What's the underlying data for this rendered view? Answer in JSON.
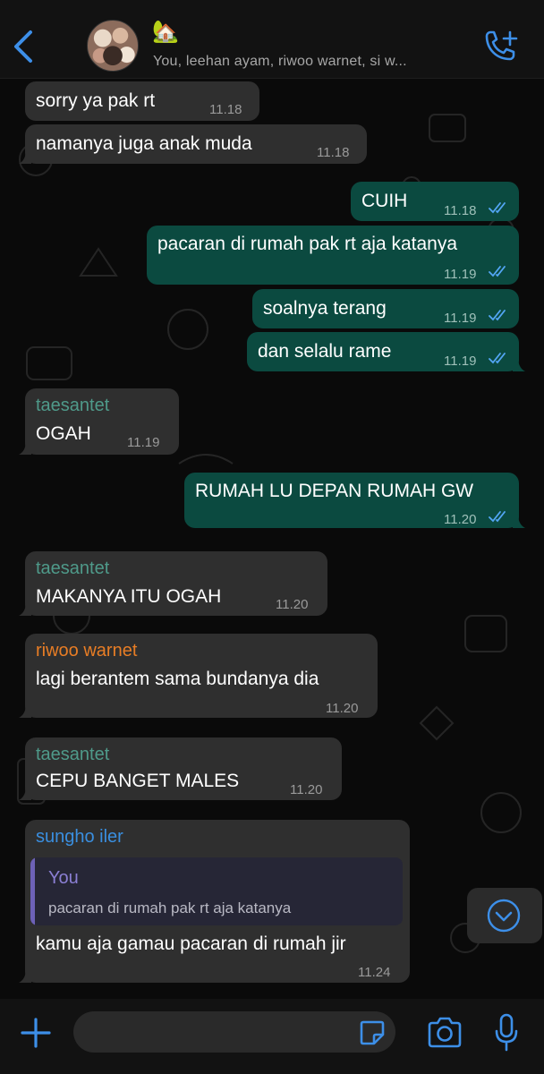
{
  "header": {
    "group_emoji": "🏡",
    "members": "You, leehan ayam, riwoo warnet, si w..."
  },
  "composer": {
    "placeholder": ""
  },
  "colors": {
    "accent": "#3d8fe8",
    "incoming_bubble": "#2f2f2f",
    "outgoing_bubble": "#0b4a40",
    "sender_taesantet": "#4f9a8a",
    "sender_riwoo": "#e87d25",
    "sender_sungho": "#3a8fe0",
    "quote_name": "#8b7fd4",
    "read_ticks": "#53a6f5"
  },
  "messages": [
    {
      "dir": "in",
      "text": "sorry ya pak rt",
      "time": "11.18"
    },
    {
      "dir": "in",
      "text": "namanya juga anak muda",
      "time": "11.18"
    },
    {
      "dir": "out",
      "text": "CUIH",
      "time": "11.18",
      "status": "read"
    },
    {
      "dir": "out",
      "text": "pacaran di rumah pak rt aja katanya",
      "time": "11.19",
      "status": "read"
    },
    {
      "dir": "out",
      "text": "soalnya terang",
      "time": "11.19",
      "status": "read"
    },
    {
      "dir": "out",
      "text": "dan selalu rame",
      "time": "11.19",
      "status": "read"
    },
    {
      "dir": "in",
      "sender": "taesantet",
      "text": "OGAH",
      "time": "11.19"
    },
    {
      "dir": "out",
      "text": "RUMAH LU DEPAN RUMAH GW",
      "time": "11.20",
      "status": "read"
    },
    {
      "dir": "in",
      "sender": "taesantet",
      "text": "MAKANYA ITU OGAH",
      "time": "11.20"
    },
    {
      "dir": "in",
      "sender": "riwoo warnet",
      "text": "lagi berantem sama bundanya dia",
      "time": "11.20"
    },
    {
      "dir": "in",
      "sender": "taesantet",
      "text": "CEPU BANGET MALES",
      "time": "11.20"
    },
    {
      "dir": "in",
      "sender": "sungho iler",
      "quote": {
        "name": "You",
        "text": "pacaran di rumah pak rt aja katanya"
      },
      "text": "kamu aja gamau pacaran di rumah jir",
      "time": "11.24"
    }
  ]
}
